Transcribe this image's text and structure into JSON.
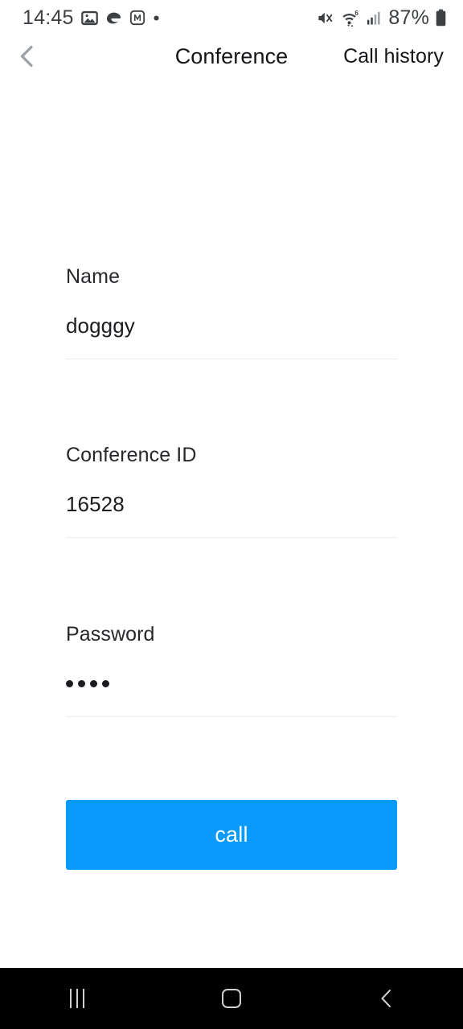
{
  "theme": {
    "accent": "#0a9afb",
    "background": "#ffffff",
    "text_primary": "#1b1d20",
    "text_secondary": "#26282b",
    "divider": "#e8eaed",
    "navbar_background": "#000000",
    "navbar_icon": "#cfcfcf",
    "back_chevron": "#9aa0a6"
  },
  "status_bar": {
    "clock": "14:45",
    "left_icons": [
      "gallery-icon",
      "opera-icon",
      "m-app-icon",
      "dot-indicator-icon"
    ],
    "right_icons": [
      "mute-icon",
      "wifi-6-icon",
      "cellular-signal-icon"
    ],
    "battery_percent": "87%",
    "battery_icon": "battery-icon",
    "wifi_generation": "6"
  },
  "header": {
    "back_icon": "chevron-left-icon",
    "title": "Conference",
    "call_history_label": "Call history"
  },
  "form": {
    "fields": [
      {
        "label": "Name",
        "value": "dogggy",
        "placeholder": "Name",
        "masked": false
      },
      {
        "label": "Conference ID",
        "value": "16528",
        "placeholder": "Conference ID",
        "masked": false
      },
      {
        "label": "Password",
        "value": "····",
        "placeholder": "Password",
        "masked": true,
        "mask_dots": 4
      }
    ]
  },
  "actions": {
    "call_label": "call"
  },
  "nav_bar": {
    "buttons": [
      {
        "name": "recents-button",
        "icon": "recents-icon"
      },
      {
        "name": "home-button",
        "icon": "home-icon"
      },
      {
        "name": "back-button",
        "icon": "chevron-left-icon"
      }
    ]
  }
}
